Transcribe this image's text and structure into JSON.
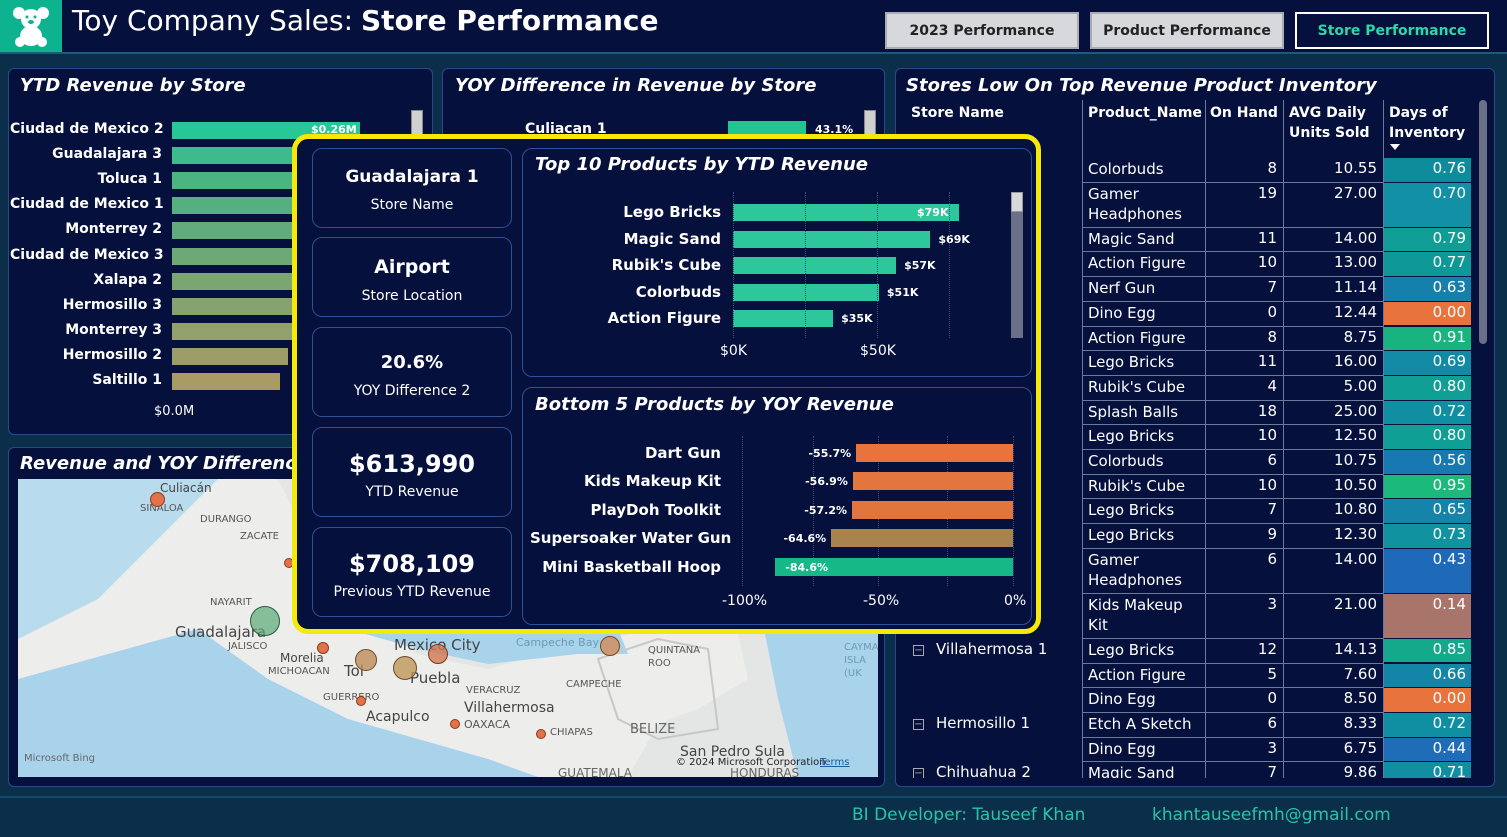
{
  "header": {
    "title": "Toy Company Sales:",
    "subtitle": "Store Performance",
    "nav": [
      {
        "label": "2023 Performance",
        "active": false
      },
      {
        "label": "Product Performance",
        "active": false
      },
      {
        "label": "Store Performance",
        "active": true
      }
    ]
  },
  "ytd_revenue_by_store": {
    "title": "YTD Revenue by Store",
    "stores": [
      "Ciudad de Mexico 2",
      "Guadalajara 3",
      "Toluca 1",
      "Ciudad de Mexico 1",
      "Monterrey 2",
      "Ciudad de Mexico 3",
      "Xalapa 2",
      "Hermosillo 3",
      "Monterrey 3",
      "Hermosillo 2",
      "Saltillo 1"
    ],
    "values_m": [
      0.26,
      0.25,
      0.24,
      0.23,
      0.22,
      0.21,
      0.2,
      0.18,
      0.17,
      0.16,
      0.15
    ],
    "first_value_label": "$0.26M",
    "axis_start": "$0.0M"
  },
  "yoy_difference_by_store": {
    "title": "YOY Difference in Revenue by Store",
    "first_store": "Culiacan 1",
    "first_value_label": "43.1%"
  },
  "map": {
    "title": "Revenue and YOY Difference by",
    "labels": {
      "culiacan": "Culiacán",
      "sinaloa": "SINALOA",
      "durango": "DURANGO",
      "zacatecas": "ZACATE",
      "nayarit": "NAYARIT",
      "guadalajara": "Guadalajara",
      "jalisco": "JALISCO",
      "morelia": "Morelia",
      "michoacan": "MICHOACAN",
      "guerrero": "GUERRERO",
      "acapulco": "Acapulco",
      "mexico_city": "Mexico City",
      "toluca": "Tol",
      "puebla": "Puebla",
      "veracruz": "VERACRUZ",
      "villahermosa": "Villahermosa",
      "oaxaca": "OAXACA",
      "chiapas": "CHIAPAS",
      "campeche_bay": "Campeche Bay",
      "quintana_roo": "QUINTANA ROO",
      "campeche": "CAMPECHE",
      "belize": "BELIZE",
      "cayman": "CAYMA ISLA (UK",
      "san_pedro": "San Pedro Sula",
      "guatemala": "GUATEMALA",
      "honduras": "HONDURAS"
    },
    "bing": "Microsoft Bing",
    "copyright": "© 2024 Microsoft Corporation",
    "terms": "Terms"
  },
  "inventory_table": {
    "title": "Stores Low On Top Revenue Product Inventory",
    "columns": [
      "Store Name",
      "Product_Name",
      "On Hand",
      "AVG Daily Units Sold",
      "Days of Inventory"
    ],
    "rows": [
      {
        "store": "",
        "product": "Colorbuds",
        "on_hand": "8",
        "avg": "10.55",
        "days": "0.76",
        "color": "#0f8c9c"
      },
      {
        "store": "",
        "product": "Gamer Headphones",
        "on_hand": "19",
        "avg": "27.00",
        "days": "0.70",
        "color": "#1290a6",
        "tall": true
      },
      {
        "store": "",
        "product": "Magic Sand",
        "on_hand": "11",
        "avg": "14.00",
        "days": "0.79",
        "color": "#0f9d96"
      },
      {
        "store": "",
        "product": "Action Figure",
        "on_hand": "10",
        "avg": "13.00",
        "days": "0.77",
        "color": "#0f9898"
      },
      {
        "store": "",
        "product": "Nerf Gun",
        "on_hand": "7",
        "avg": "11.14",
        "days": "0.63",
        "color": "#1580ab"
      },
      {
        "store": "",
        "product": "Dino Egg",
        "on_hand": "0",
        "avg": "12.44",
        "days": "0.00",
        "color": "#e8733c"
      },
      {
        "store": "",
        "product": "Action Figure",
        "on_hand": "8",
        "avg": "8.75",
        "days": "0.91",
        "color": "#18b37f"
      },
      {
        "store": "",
        "product": "Lego Bricks",
        "on_hand": "11",
        "avg": "16.00",
        "days": "0.69",
        "color": "#138aa5"
      },
      {
        "store": "",
        "product": "Rubik's Cube",
        "on_hand": "4",
        "avg": "5.00",
        "days": "0.80",
        "color": "#0f9f95"
      },
      {
        "store": "",
        "product": "Splash Balls",
        "on_hand": "18",
        "avg": "25.00",
        "days": "0.72",
        "color": "#118fa2"
      },
      {
        "store": "",
        "product": "Lego Bricks",
        "on_hand": "10",
        "avg": "12.50",
        "days": "0.80",
        "color": "#0f9f95"
      },
      {
        "store": "",
        "product": "Colorbuds",
        "on_hand": "6",
        "avg": "10.75",
        "days": "0.56",
        "color": "#1878b2"
      },
      {
        "store": "",
        "product": "Rubik's Cube",
        "on_hand": "10",
        "avg": "10.50",
        "days": "0.95",
        "color": "#1bb97b"
      },
      {
        "store": "",
        "product": "Lego Bricks",
        "on_hand": "7",
        "avg": "10.80",
        "days": "0.65",
        "color": "#1484a9"
      },
      {
        "store": "",
        "product": "Lego Bricks",
        "on_hand": "9",
        "avg": "12.30",
        "days": "0.73",
        "color": "#1192a0"
      },
      {
        "store": "",
        "product": "Gamer Headphones",
        "on_hand": "6",
        "avg": "14.00",
        "days": "0.43",
        "color": "#1f6ab8",
        "tall": true
      },
      {
        "store": "",
        "product": "Kids Makeup Kit",
        "on_hand": "3",
        "avg": "21.00",
        "days": "0.14",
        "color": "#a9756a",
        "tall": true
      },
      {
        "store": "Villahermosa 1",
        "product": "Lego Bricks",
        "on_hand": "12",
        "avg": "14.13",
        "days": "0.85",
        "color": "#14a98a"
      },
      {
        "store": "",
        "product": "Action Figure",
        "on_hand": "5",
        "avg": "7.60",
        "days": "0.66",
        "color": "#1386a8"
      },
      {
        "store": "",
        "product": "Dino Egg",
        "on_hand": "0",
        "avg": "8.50",
        "days": "0.00",
        "color": "#e8733c"
      },
      {
        "store": "Hermosillo 1",
        "product": "Etch A Sketch",
        "on_hand": "6",
        "avg": "8.33",
        "days": "0.72",
        "color": "#118fa2"
      },
      {
        "store": "",
        "product": "Dino Egg",
        "on_hand": "3",
        "avg": "6.75",
        "days": "0.44",
        "color": "#1f6cb8"
      },
      {
        "store": "Chihuahua 2",
        "product": "Magic Sand",
        "on_hand": "7",
        "avg": "9.86",
        "days": "0.71",
        "color": "#128ea3"
      }
    ]
  },
  "tooltip": {
    "cards": [
      {
        "value": "Guadalajara 1",
        "label": "Store Name"
      },
      {
        "value": "Airport",
        "label": "Store Location"
      },
      {
        "value": "20.6%",
        "label": "YOY Difference 2"
      },
      {
        "value": "$613,990",
        "label": "YTD Revenue"
      },
      {
        "value": "$708,109",
        "label": "Previous YTD Revenue"
      }
    ],
    "top_chart": {
      "title": "Top 10 Products by YTD Revenue",
      "products": [
        "Lego Bricks",
        "Magic Sand",
        "Rubik's Cube",
        "Colorbuds",
        "Action Figure"
      ],
      "values_k": [
        79,
        69,
        57,
        51,
        35
      ],
      "labels": [
        "$79K",
        "$69K",
        "$57K",
        "$51K",
        "$35K"
      ],
      "ticks": [
        "$0K",
        "$50K"
      ]
    },
    "bottom_chart": {
      "title": "Bottom 5 Products by YOY Revenue",
      "products": [
        "Dart Gun",
        "Kids Makeup Kit",
        "PlayDoh Toolkit",
        "Supersoaker Water Gun",
        "Mini Basketball Hoop"
      ],
      "values_pct": [
        -55.7,
        -56.9,
        -57.2,
        -64.6,
        -84.6
      ],
      "labels": [
        "-55.7%",
        "-56.9%",
        "-57.2%",
        "-64.6%",
        "-84.6%"
      ],
      "colors": [
        "#e8733c",
        "#e3753e",
        "#e0763e",
        "#a8834e",
        "#15b987"
      ],
      "ticks": [
        "-100%",
        "-50%",
        "0%"
      ]
    }
  },
  "footer": {
    "developer": "BI Developer: Tauseef Khan",
    "email": "khantauseefmh@gmail.com"
  },
  "chart_data": [
    {
      "type": "bar",
      "title": "YTD Revenue by Store",
      "categories": [
        "Ciudad de Mexico 2",
        "Guadalajara 3",
        "Toluca 1",
        "Ciudad de Mexico 1",
        "Monterrey 2",
        "Ciudad de Mexico 3",
        "Xalapa 2",
        "Hermosillo 3",
        "Monterrey 3",
        "Hermosillo 2",
        "Saltillo 1"
      ],
      "values": [
        0.26,
        0.25,
        0.24,
        0.23,
        0.22,
        0.21,
        0.2,
        0.18,
        0.17,
        0.16,
        0.15
      ]
    },
    {
      "type": "bar",
      "title": "Top 10 Products by YTD Revenue",
      "categories": [
        "Lego Bricks",
        "Magic Sand",
        "Rubik's Cube",
        "Colorbuds",
        "Action Figure"
      ],
      "values": [
        79,
        69,
        57,
        51,
        35
      ]
    },
    {
      "type": "bar",
      "title": "Bottom 5 Products by YOY Revenue",
      "categories": [
        "Dart Gun",
        "Kids Makeup Kit",
        "PlayDoh Toolkit",
        "Supersoaker Water Gun",
        "Mini Basketball Hoop"
      ],
      "values": [
        -55.7,
        -56.9,
        -57.2,
        -64.6,
        -84.6
      ],
      "xlim": [
        -100,
        0
      ]
    }
  ]
}
